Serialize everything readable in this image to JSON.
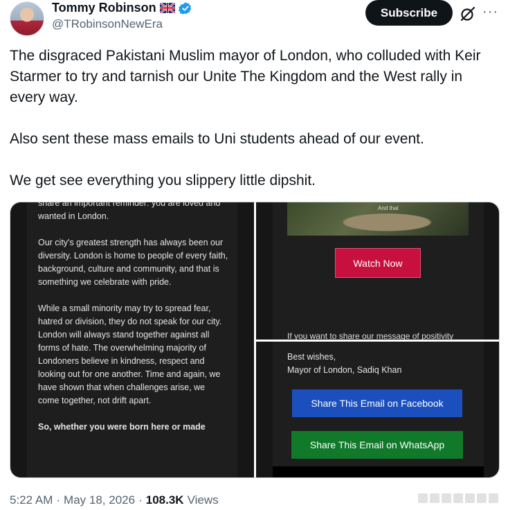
{
  "author": {
    "name": "Tommy Robinson",
    "handle": "@TRobinsonNewEra"
  },
  "header": {
    "subscribe_label": "Subscribe",
    "more_label": "···"
  },
  "tweet": {
    "paragraphs": [
      "The disgraced Pakistani Muslim mayor of London, who colluded with Keir Starmer to try and tarnish our Unite The Kingdom and the West rally in every way.",
      "Also sent these mass emails to Uni students ahead of our event.",
      "We get see everything you slippery little dipshit."
    ]
  },
  "media": {
    "left": {
      "paragraphs": [
        "share an important reminder: you are loved and wanted in London.",
        "Our city's greatest strength has always been our diversity. London is home to people of every faith, background, culture and community, and that is something we celebrate with pride.",
        "While a small minority may try to spread fear, hatred or division, they do not speak for our city. London will always stand together against all forms of hate. The overwhelming majority of Londoners believe in kindness, respect and looking out for one another. Time and again, we have shown that when challenges arise, we come together, not drift apart.",
        "So, whether you were born here or made"
      ]
    },
    "top_right": {
      "video_caption": "And that",
      "watch_label": "Watch Now",
      "share_cut_text": "If you want to share our message of positivity"
    },
    "bottom_right": {
      "sign_line1": "Best wishes,",
      "sign_line2": "Mayor of London, Sadiq Khan",
      "facebook_label": "Share This Email on Facebook",
      "whatsapp_label": "Share This Email on WhatsApp"
    }
  },
  "meta": {
    "time": "5:22 AM",
    "date": "May 18, 2026",
    "views_count": "108.3K",
    "views_label": "Views"
  },
  "colors": {
    "watch_button": "#c8103e",
    "facebook_button": "#1b4fbd",
    "whatsapp_button": "#107a2a"
  }
}
